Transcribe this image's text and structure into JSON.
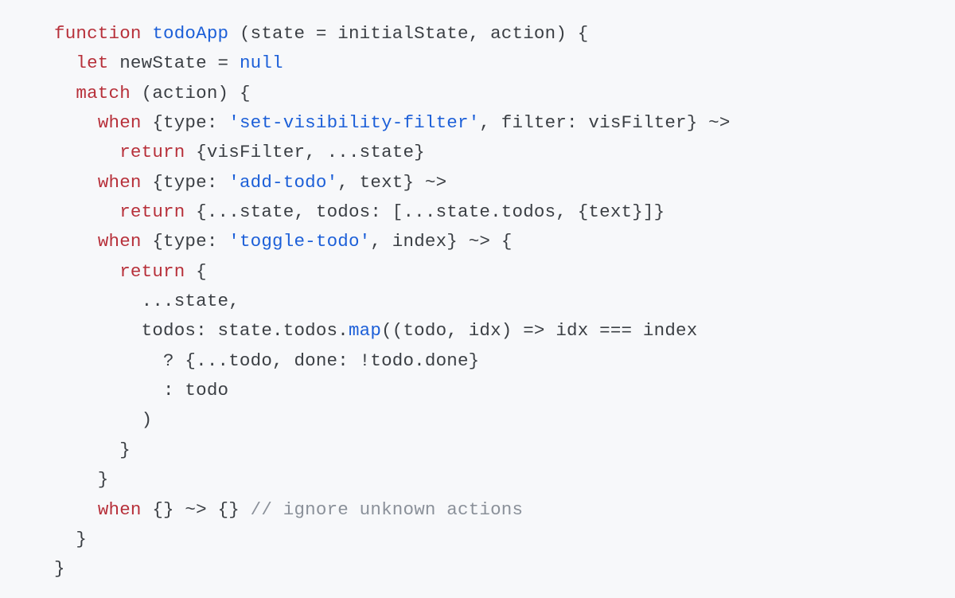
{
  "code": {
    "lines": [
      [
        {
          "t": "function",
          "c": "kw"
        },
        {
          "t": " "
        },
        {
          "t": "todoApp",
          "c": "fn"
        },
        {
          "t": " (state = initialState, action) {"
        }
      ],
      [
        {
          "t": "  "
        },
        {
          "t": "let",
          "c": "kw"
        },
        {
          "t": " newState = "
        },
        {
          "t": "null",
          "c": "lit"
        }
      ],
      [
        {
          "t": "  "
        },
        {
          "t": "match",
          "c": "kw"
        },
        {
          "t": " (action) {"
        }
      ],
      [
        {
          "t": "    "
        },
        {
          "t": "when",
          "c": "kw"
        },
        {
          "t": " {type: "
        },
        {
          "t": "'set-visibility-filter'",
          "c": "str"
        },
        {
          "t": ", filter: visFilter} ~>"
        }
      ],
      [
        {
          "t": "      "
        },
        {
          "t": "return",
          "c": "kw"
        },
        {
          "t": " {visFilter, ...state}"
        }
      ],
      [
        {
          "t": "    "
        },
        {
          "t": "when",
          "c": "kw"
        },
        {
          "t": " {type: "
        },
        {
          "t": "'add-todo'",
          "c": "str"
        },
        {
          "t": ", text} ~>"
        }
      ],
      [
        {
          "t": "      "
        },
        {
          "t": "return",
          "c": "kw"
        },
        {
          "t": " {...state, todos: [...state.todos, {text}]}"
        }
      ],
      [
        {
          "t": "    "
        },
        {
          "t": "when",
          "c": "kw"
        },
        {
          "t": " {type: "
        },
        {
          "t": "'toggle-todo'",
          "c": "str"
        },
        {
          "t": ", index} ~> {"
        }
      ],
      [
        {
          "t": "      "
        },
        {
          "t": "return",
          "c": "kw"
        },
        {
          "t": " {"
        }
      ],
      [
        {
          "t": "        ...state,"
        }
      ],
      [
        {
          "t": "        todos: state.todos."
        },
        {
          "t": "map",
          "c": "fn"
        },
        {
          "t": "((todo, idx) => idx === index"
        }
      ],
      [
        {
          "t": "          ? {...todo, done: !todo.done}"
        }
      ],
      [
        {
          "t": "          : todo"
        }
      ],
      [
        {
          "t": "        )"
        }
      ],
      [
        {
          "t": "      }"
        }
      ],
      [
        {
          "t": "    }"
        }
      ],
      [
        {
          "t": "    "
        },
        {
          "t": "when",
          "c": "kw"
        },
        {
          "t": " {} ~> {} "
        },
        {
          "t": "// ignore unknown actions",
          "c": "cmt"
        }
      ],
      [
        {
          "t": "  }"
        }
      ],
      [
        {
          "t": "}"
        }
      ]
    ]
  }
}
